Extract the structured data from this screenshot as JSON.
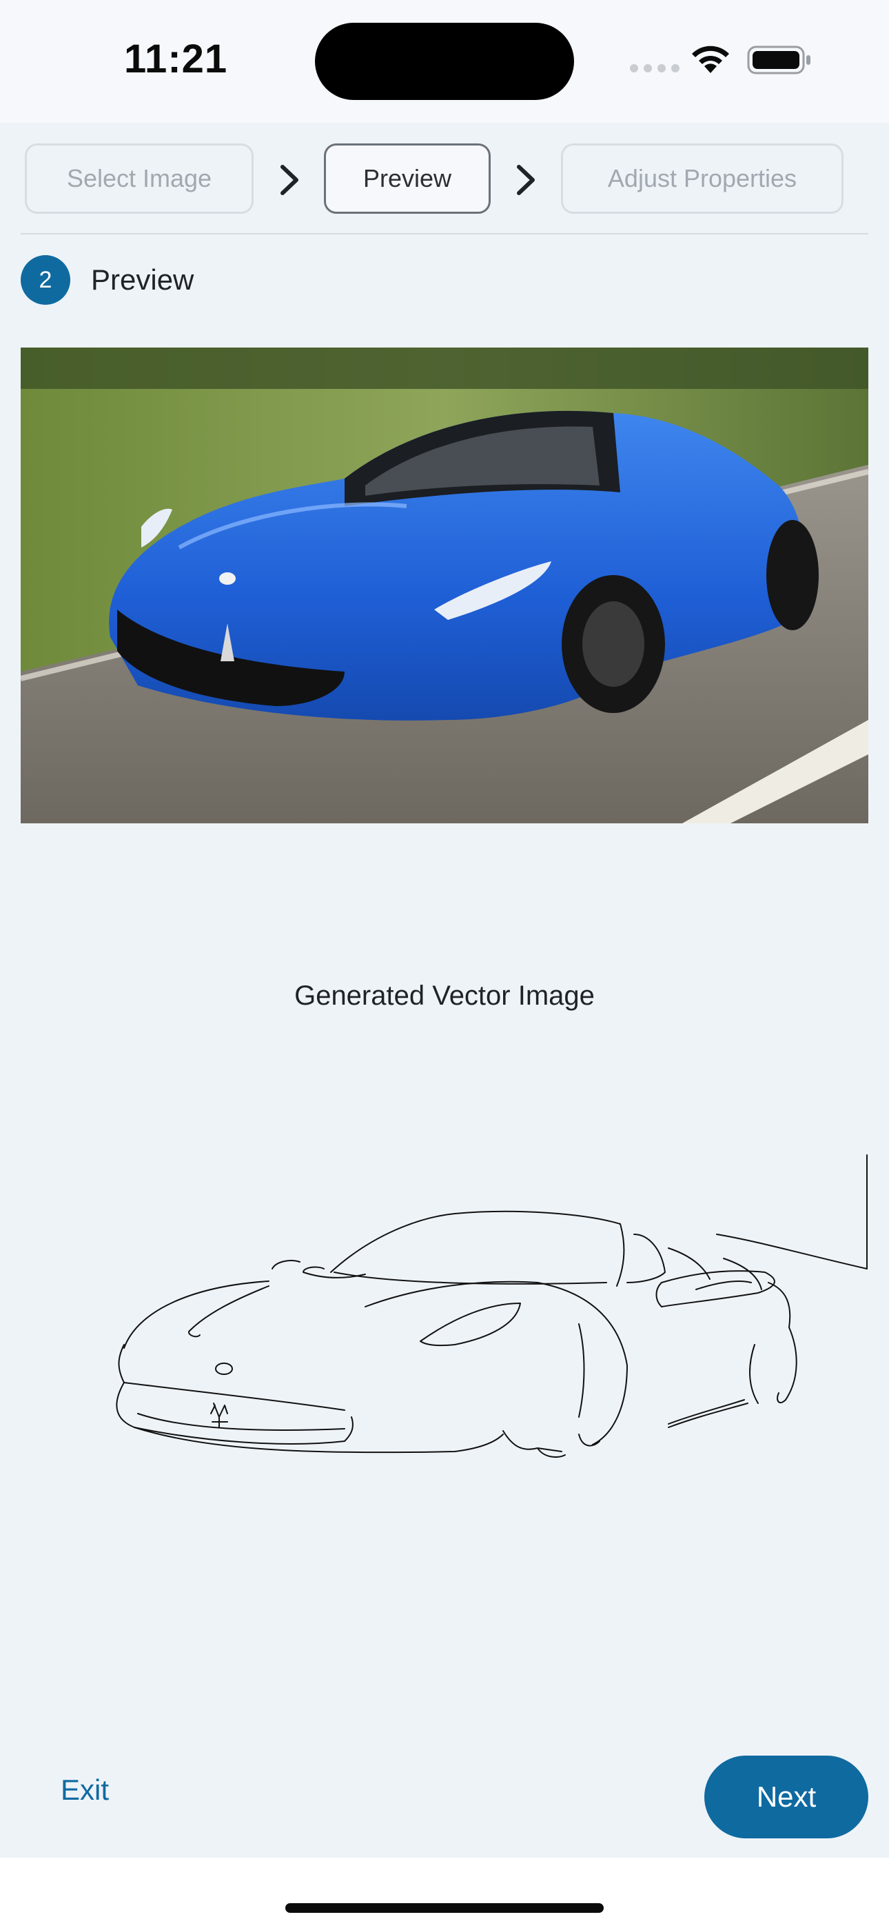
{
  "status_bar": {
    "time": "11:21",
    "icons": [
      "cellular-dots-icon",
      "wifi-icon",
      "battery-icon"
    ]
  },
  "stepper": {
    "steps": [
      {
        "label": "Select Image",
        "state": "inactive"
      },
      {
        "label": "Preview",
        "state": "active"
      },
      {
        "label": "Adjust Properties",
        "state": "inactive"
      }
    ]
  },
  "section": {
    "number": "2",
    "title": "Preview"
  },
  "vector": {
    "caption": "Generated Vector Image"
  },
  "footer": {
    "exit_label": "Exit",
    "next_label": "Next"
  },
  "colors": {
    "accent": "#0f6aa0",
    "background": "#eef3f8",
    "car_blue": "#1f5fd6"
  }
}
